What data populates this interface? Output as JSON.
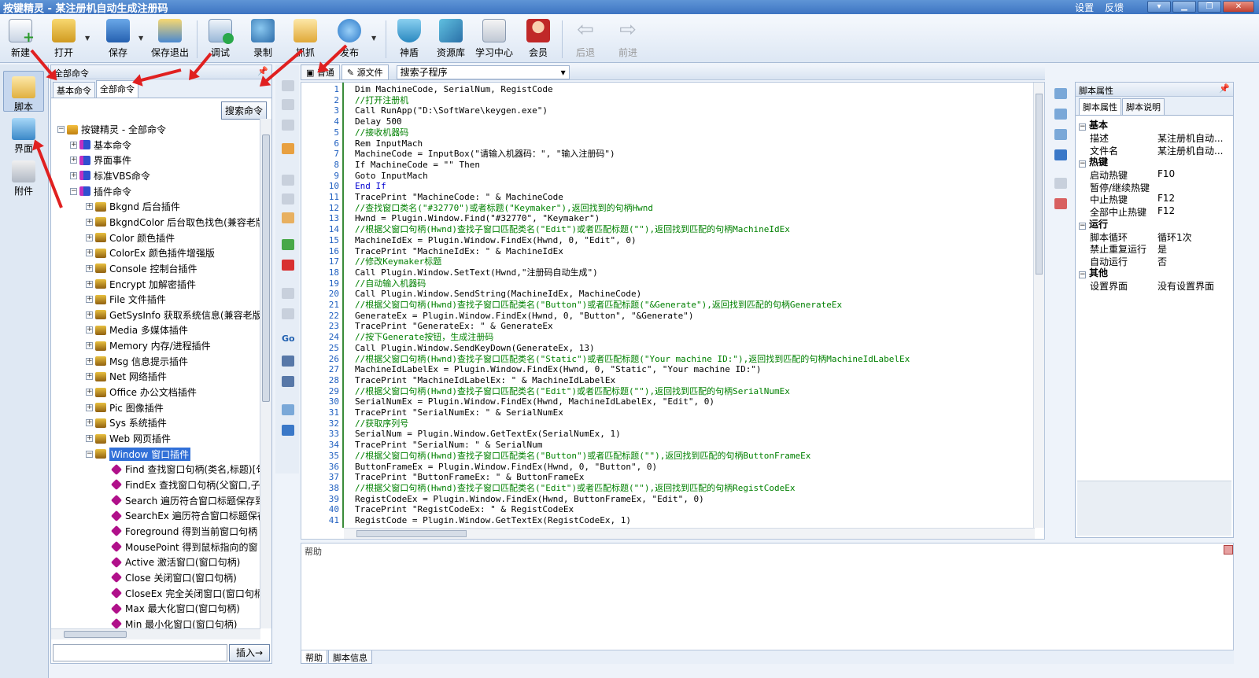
{
  "window": {
    "title": "按键精灵 - 某注册机自动生成注册码",
    "links": [
      "设置",
      "反馈"
    ],
    "buttons": {
      "minimize": "▁",
      "restore": "❐",
      "maximize": "□",
      "close": "✕"
    }
  },
  "toolbar": {
    "new": "新建",
    "open": "打开",
    "save": "保存",
    "save_exit": "保存退出",
    "debug": "调试",
    "record": "录制",
    "capture": "抓抓",
    "publish": "发布",
    "shield": "神盾",
    "resources": "资源库",
    "learn": "学习中心",
    "member": "会员",
    "back": "后退",
    "forward": "前进"
  },
  "sidebar": {
    "script": "脚本",
    "ui": "界面",
    "attach": "附件"
  },
  "commands": {
    "header": "全部命令",
    "tabs": [
      "基本命令",
      "全部命令"
    ],
    "search_button": "搜索命令",
    "insert_button": "插入→",
    "tree": [
      {
        "label": "按键精灵 - 全部命令",
        "level": 0,
        "expander": "⊟",
        "icon": "root"
      },
      {
        "label": "基本命令",
        "level": 1,
        "expander": "⊞",
        "icon": "blue"
      },
      {
        "label": "界面事件",
        "level": 1,
        "expander": "⊞",
        "icon": "blue"
      },
      {
        "label": "标准VBS命令",
        "level": 1,
        "expander": "⊞",
        "icon": "blue"
      },
      {
        "label": "插件命令",
        "level": 1,
        "expander": "⊟",
        "icon": "blue"
      },
      {
        "label": "Bkgnd 后台插件",
        "level": 2,
        "expander": "⊞",
        "icon": "key"
      },
      {
        "label": "BkgndColor 后台取色找色(兼容老版",
        "level": 2,
        "expander": "⊞",
        "icon": "key"
      },
      {
        "label": "Color 颜色插件",
        "level": 2,
        "expander": "⊞",
        "icon": "key"
      },
      {
        "label": "ColorEx 颜色插件增强版",
        "level": 2,
        "expander": "⊞",
        "icon": "key"
      },
      {
        "label": "Console 控制台插件",
        "level": 2,
        "expander": "⊞",
        "icon": "key"
      },
      {
        "label": "Encrypt 加解密插件",
        "level": 2,
        "expander": "⊞",
        "icon": "key"
      },
      {
        "label": "File 文件插件",
        "level": 2,
        "expander": "⊞",
        "icon": "key"
      },
      {
        "label": "GetSysInfo 获取系统信息(兼容老版",
        "level": 2,
        "expander": "⊞",
        "icon": "key"
      },
      {
        "label": "Media 多媒体插件",
        "level": 2,
        "expander": "⊞",
        "icon": "key"
      },
      {
        "label": "Memory 内存/进程插件",
        "level": 2,
        "expander": "⊞",
        "icon": "key"
      },
      {
        "label": "Msg 信息提示插件",
        "level": 2,
        "expander": "⊞",
        "icon": "key"
      },
      {
        "label": "Net 网络插件",
        "level": 2,
        "expander": "⊞",
        "icon": "key"
      },
      {
        "label": "Office 办公文档插件",
        "level": 2,
        "expander": "⊞",
        "icon": "key"
      },
      {
        "label": "Pic 图像插件",
        "level": 2,
        "expander": "⊞",
        "icon": "key"
      },
      {
        "label": "Sys 系统插件",
        "level": 2,
        "expander": "⊞",
        "icon": "key"
      },
      {
        "label": "Web 网页插件",
        "level": 2,
        "expander": "⊞",
        "icon": "key"
      },
      {
        "label": "Window 窗口插件",
        "level": 2,
        "expander": "⊟",
        "icon": "key",
        "selected": true
      },
      {
        "label": "Find 查找窗口句柄(类名,标题)[句",
        "level": 3,
        "expander": "",
        "icon": "dia"
      },
      {
        "label": "FindEx 查找窗口句柄(父窗口,子",
        "level": 3,
        "expander": "",
        "icon": "dia"
      },
      {
        "label": "Search 遍历符合窗口标题保存到",
        "level": 3,
        "expander": "",
        "icon": "dia"
      },
      {
        "label": "SearchEx 遍历符合窗口标题保存",
        "level": 3,
        "expander": "",
        "icon": "dia"
      },
      {
        "label": "Foreground 得到当前窗口句柄",
        "level": 3,
        "expander": "",
        "icon": "dia"
      },
      {
        "label": "MousePoint 得到鼠标指向的窗",
        "level": 3,
        "expander": "",
        "icon": "dia"
      },
      {
        "label": "Active 激活窗口(窗口句柄)",
        "level": 3,
        "expander": "",
        "icon": "dia"
      },
      {
        "label": "Close 关闭窗口(窗口句柄)",
        "level": 3,
        "expander": "",
        "icon": "dia"
      },
      {
        "label": "CloseEx 完全关闭窗口(窗口句柄",
        "level": 3,
        "expander": "",
        "icon": "dia"
      },
      {
        "label": "Max 最大化窗口(窗口句柄)",
        "level": 3,
        "expander": "",
        "icon": "dia"
      },
      {
        "label": "Min 最小化窗口(窗口句柄)",
        "level": 3,
        "expander": "",
        "icon": "dia"
      }
    ]
  },
  "editor": {
    "tabs": [
      "普通",
      "源文件"
    ],
    "sub_select": "搜索子程序",
    "lines": [
      {
        "t": "Dim MachineCode, SerialNum, RegistCode",
        "k": "code"
      },
      {
        "t": "//打开注册机",
        "k": "com"
      },
      {
        "t": "Call RunApp(\"D:\\SoftWare\\keygen.exe\")",
        "k": "code"
      },
      {
        "t": "Delay 500",
        "k": "code"
      },
      {
        "t": "//接收机器码",
        "k": "com"
      },
      {
        "t": "Rem InputMach",
        "k": "code"
      },
      {
        "t": "MachineCode = InputBox(\"请输入机器码：\", \"输入注册码\")",
        "k": "code"
      },
      {
        "t": "If MachineCode = \"\" Then",
        "k": "code"
      },
      {
        "t": "Goto InputMach",
        "k": "code"
      },
      {
        "t": "End If",
        "k": "kw"
      },
      {
        "t": "TracePrint \"MachineCode: \" & MachineCode",
        "k": "code"
      },
      {
        "t": "//查找窗口类名(\"#32770\")或者标题(\"Keymaker\"),返回找到的句柄Hwnd",
        "k": "com"
      },
      {
        "t": "Hwnd = Plugin.Window.Find(\"#32770\", \"Keymaker\")",
        "k": "code"
      },
      {
        "t": "//根据父窗口句柄(Hwnd)查找子窗口匹配类名(\"Edit\")或者匹配标题(\"\"),返回找到匹配的句柄MachineIdEx",
        "k": "com"
      },
      {
        "t": "MachineIdEx = Plugin.Window.FindEx(Hwnd, 0, \"Edit\", 0)",
        "k": "code"
      },
      {
        "t": "TracePrint \"MachineIdEx: \" & MachineIdEx",
        "k": "code"
      },
      {
        "t": "//修改Keymaker标题",
        "k": "com"
      },
      {
        "t": "Call Plugin.Window.SetText(Hwnd,\"注册码自动生成\")",
        "k": "code"
      },
      {
        "t": "//自动输入机器码",
        "k": "com"
      },
      {
        "t": "Call Plugin.Window.SendString(MachineIdEx, MachineCode)",
        "k": "code"
      },
      {
        "t": "//根据父窗口句柄(Hwnd)查找子窗口匹配类名(\"Button\")或者匹配标题(\"&Generate\"),返回找到匹配的句柄GenerateEx",
        "k": "com"
      },
      {
        "t": "GenerateEx = Plugin.Window.FindEx(Hwnd, 0, \"Button\", \"&Generate\")",
        "k": "code"
      },
      {
        "t": "TracePrint \"GenerateEx: \" & GenerateEx",
        "k": "code"
      },
      {
        "t": "//按下Generate按钮，生成注册码",
        "k": "com"
      },
      {
        "t": "Call Plugin.Window.SendKeyDown(GenerateEx, 13)",
        "k": "code"
      },
      {
        "t": "//根据父窗口句柄(Hwnd)查找子窗口匹配类名(\"Static\")或者匹配标题(\"Your machine ID:\"),返回找到匹配的句柄MachineIdLabelEx",
        "k": "com"
      },
      {
        "t": "MachineIdLabelEx = Plugin.Window.FindEx(Hwnd, 0, \"Static\", \"Your machine ID:\")",
        "k": "code"
      },
      {
        "t": "TracePrint \"MachineIdLabelEx: \" & MachineIdLabelEx",
        "k": "code"
      },
      {
        "t": "//根据父窗口句柄(Hwnd)查找子窗口匹配类名(\"Edit\")或者匹配标题(\"\"),返回找到匹配的句柄SerialNumEx",
        "k": "com"
      },
      {
        "t": "SerialNumEx = Plugin.Window.FindEx(Hwnd, MachineIdLabelEx, \"Edit\", 0)",
        "k": "code"
      },
      {
        "t": "TracePrint \"SerialNumEx: \" & SerialNumEx",
        "k": "code"
      },
      {
        "t": "//获取序列号",
        "k": "com"
      },
      {
        "t": "SerialNum = Plugin.Window.GetTextEx(SerialNumEx, 1)",
        "k": "code"
      },
      {
        "t": "TracePrint \"SerialNum: \" & SerialNum",
        "k": "code"
      },
      {
        "t": "//根据父窗口句柄(Hwnd)查找子窗口匹配类名(\"Button\")或者匹配标题(\"\"),返回找到匹配的句柄ButtonFrameEx",
        "k": "com"
      },
      {
        "t": "ButtonFrameEx = Plugin.Window.FindEx(Hwnd, 0, \"Button\", 0)",
        "k": "code"
      },
      {
        "t": "TracePrint \"ButtonFrameEx: \" & ButtonFrameEx",
        "k": "code"
      },
      {
        "t": "//根据父窗口句柄(Hwnd)查找子窗口匹配类名(\"Edit\")或者匹配标题(\"\"),返回找到匹配的句柄RegistCodeEx",
        "k": "com"
      },
      {
        "t": "RegistCodeEx = Plugin.Window.FindEx(Hwnd, ButtonFrameEx, \"Edit\", 0)",
        "k": "code"
      },
      {
        "t": "TracePrint \"RegistCodeEx: \" & RegistCodeEx",
        "k": "code"
      },
      {
        "t": "RegistCode = Plugin.Window.GetTextEx(RegistCodeEx, 1)",
        "k": "code"
      }
    ]
  },
  "properties": {
    "header": "脚本属性",
    "tabs": [
      "脚本属性",
      "脚本说明"
    ],
    "groups": [
      {
        "name": "基本",
        "rows": [
          [
            "描述",
            "某注册机自动..."
          ],
          [
            "文件名",
            "某注册机自动..."
          ]
        ]
      },
      {
        "name": "热键",
        "rows": [
          [
            "启动热键",
            "F10"
          ],
          [
            "暂停/继续热键",
            ""
          ],
          [
            "中止热键",
            "F12"
          ],
          [
            "全部中止热键",
            "F12"
          ]
        ]
      },
      {
        "name": "运行",
        "rows": [
          [
            "脚本循环",
            "循环1次"
          ],
          [
            "禁止重复运行",
            "是"
          ],
          [
            "自动运行",
            "否"
          ]
        ]
      },
      {
        "name": "其他",
        "rows": [
          [
            "设置界面",
            "没有设置界面"
          ]
        ]
      }
    ]
  },
  "help": {
    "title": "帮助",
    "tabs": [
      "帮助",
      "脚本信息"
    ]
  },
  "colors": {
    "annotation_arrow": "#e02020",
    "comment": "#008000",
    "keyword": "#0000d0",
    "selection": "#3170d8"
  }
}
